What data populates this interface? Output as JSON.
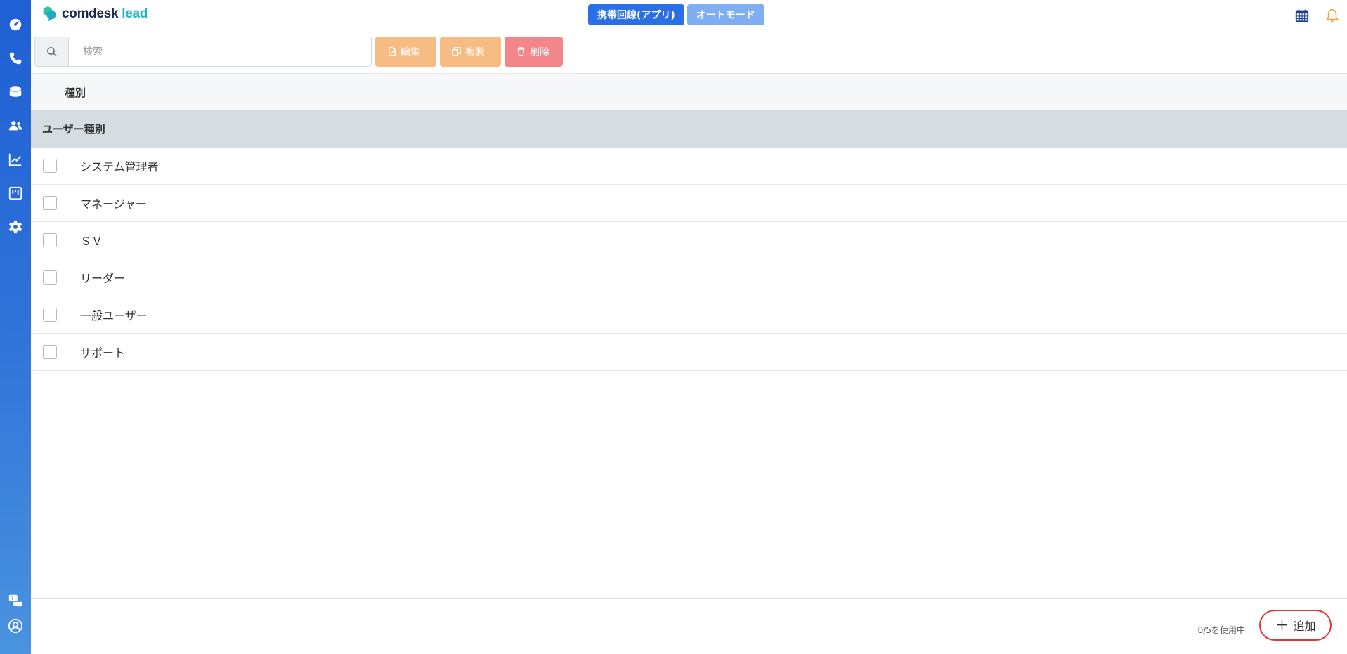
{
  "header": {
    "logo_main": "comdesk",
    "logo_accent": "lead",
    "mode_primary": "携帯回線(アプリ)",
    "mode_secondary": "オートモード"
  },
  "sidebar": {
    "items": [
      {
        "icon": "dashboard-icon"
      },
      {
        "icon": "phone-icon"
      },
      {
        "icon": "database-icon"
      },
      {
        "icon": "users-icon"
      },
      {
        "icon": "chart-line-icon"
      },
      {
        "icon": "board-icon"
      },
      {
        "icon": "gear-icon"
      }
    ],
    "bottom": [
      {
        "icon": "help-chat-icon"
      },
      {
        "icon": "account-icon"
      }
    ]
  },
  "toolbar": {
    "search_placeholder": "検索",
    "edit_label": "編集",
    "copy_label": "複製",
    "delete_label": "削除"
  },
  "table": {
    "header": "種別",
    "group": "ユーザー種別",
    "rows": [
      "システム管理者",
      "マネージャー",
      "ＳＶ",
      "リーダー",
      "一般ユーザー",
      "サポート"
    ]
  },
  "footer": {
    "usage": "0/5を使用中",
    "add_label": "追加"
  },
  "colors": {
    "sidebar": "#2f73d8",
    "primary_button": "#2a6fe6",
    "secondary_button": "#7eaef3",
    "edit_button": "#f7bc84",
    "delete_button": "#f3868a",
    "add_highlight": "#e23535"
  }
}
